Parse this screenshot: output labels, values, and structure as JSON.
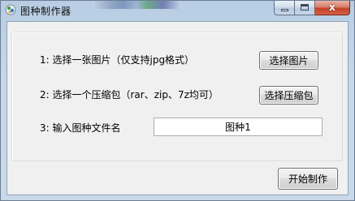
{
  "window": {
    "title": "图种制作器",
    "close_glyph": "x"
  },
  "form": {
    "step1_label": "1: 选择一张图片（仅支持jpg格式）",
    "step1_button": "选择图片",
    "step2_label": "2: 选择一个压缩包（rar、zip、7z均可）",
    "step2_button": "选择压缩包",
    "step3_label": "3: 输入图种文件名",
    "filename_value": "图种1",
    "start_button": "开始制作"
  },
  "icons": {
    "app": "app-icon",
    "minimize": "minimize-icon",
    "maximize": "maximize-icon",
    "close": "close-icon"
  }
}
